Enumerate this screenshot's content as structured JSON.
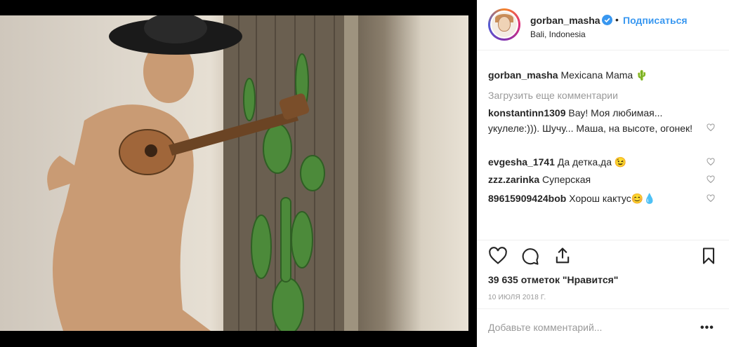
{
  "post": {
    "username": "gorban_masha",
    "follow_label": "Подписаться",
    "location": "Bali, Indonesia",
    "caption_user": "gorban_masha",
    "caption_text": "Mexicana Mama 🌵",
    "load_more": "Загрузить еще комментарии",
    "likes": "39 635 отметок \"Нравится\"",
    "date": "10 ИЮЛЯ 2018 Г.",
    "add_comment_placeholder": "Добавьте комментарий...",
    "more_label": "•••"
  },
  "comments": [
    {
      "user": "konstantinn1309",
      "text": "Вау! Моя любимая... укулеле:))). Шучу... Маша, на высоте, огонек!"
    },
    {
      "user": "evgesha_1741",
      "text": "Да детка,да 😉"
    },
    {
      "user": "zzz.zarinka",
      "text": "Суперская"
    },
    {
      "user": "89615909424bob",
      "text": "Хорош кактус😊💧"
    }
  ],
  "colors": {
    "accent": "#3897f0",
    "text": "#262626",
    "muted": "#999999"
  },
  "icons": [
    "verified-badge-icon",
    "heart-icon",
    "comment-icon",
    "share-icon",
    "bookmark-icon",
    "small-heart-icon",
    "more-options-icon"
  ]
}
